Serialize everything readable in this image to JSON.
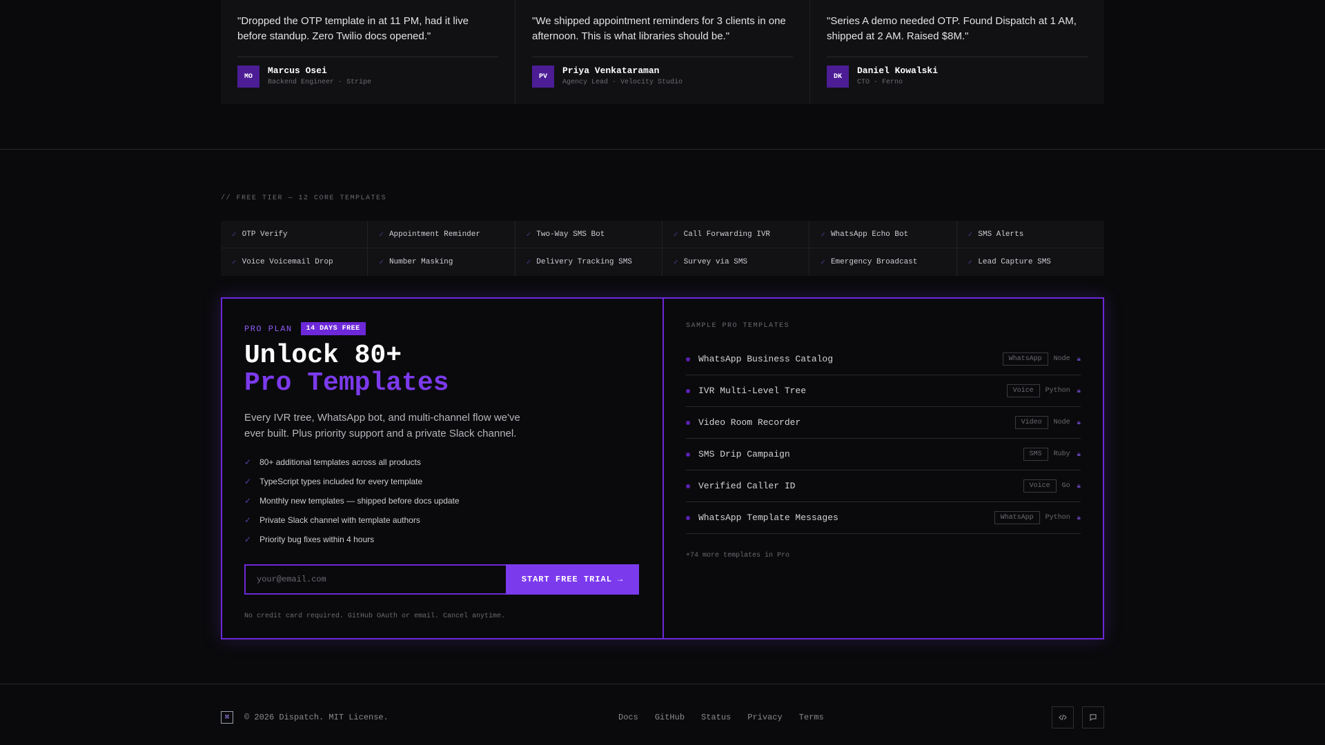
{
  "testimonials": [
    {
      "quote": "\"Dropped the OTP template in at 11 PM, had it live before standup. Zero Twilio docs opened.\"",
      "initials": "MO",
      "name": "Marcus Osei",
      "role": "Backend Engineer · Stripe"
    },
    {
      "quote": "\"We shipped appointment reminders for 3 clients in one afternoon. This is what libraries should be.\"",
      "initials": "PV",
      "name": "Priya Venkataraman",
      "role": "Agency Lead · Velocity Studio"
    },
    {
      "quote": "\"Series A demo needed OTP. Found Dispatch at 1 AM, shipped at 2 AM. Raised $8M.\"",
      "initials": "DK",
      "name": "Daniel Kowalski",
      "role": "CTO · Ferno"
    }
  ],
  "free_tier": {
    "label": "// FREE TIER — 12 CORE TEMPLATES",
    "items": [
      "OTP Verify",
      "Appointment Reminder",
      "Two-Way SMS Bot",
      "Call Forwarding IVR",
      "WhatsApp Echo Bot",
      "SMS Alerts",
      "Voice Voicemail Drop",
      "Number Masking",
      "Delivery Tracking SMS",
      "Survey via SMS",
      "Emergency Broadcast",
      "Lead Capture SMS"
    ]
  },
  "pro": {
    "plan_label": "PRO PLAN",
    "badge": "14 DAYS FREE",
    "headline_1": "Unlock 80+",
    "headline_2": "Pro Templates",
    "description": "Every IVR tree, WhatsApp bot, and multi-channel flow we've ever built. Plus priority support and a private Slack channel.",
    "features": [
      "80+ additional templates across all products",
      "TypeScript types included for every template",
      "Monthly new templates — shipped before docs update",
      "Private Slack channel with template authors",
      "Priority bug fixes within 4 hours"
    ],
    "email_placeholder": "your@email.com",
    "cta": "START FREE TRIAL →",
    "fine_print": "No credit card required. GitHub OAuth or email. Cancel anytime.",
    "accent_color": "#7c3aed"
  },
  "samples": {
    "label": "SAMPLE PRO TEMPLATES",
    "items": [
      {
        "name": "WhatsApp Business Catalog",
        "tag": "WhatsApp",
        "lang": "Node"
      },
      {
        "name": "IVR Multi-Level Tree",
        "tag": "Voice",
        "lang": "Python"
      },
      {
        "name": "Video Room Recorder",
        "tag": "Video",
        "lang": "Node"
      },
      {
        "name": "SMS Drip Campaign",
        "tag": "SMS",
        "lang": "Ruby"
      },
      {
        "name": "Verified Caller ID",
        "tag": "Voice",
        "lang": "Go"
      },
      {
        "name": "WhatsApp Template Messages",
        "tag": "WhatsApp",
        "lang": "Python"
      }
    ],
    "more": "+74 more templates in Pro"
  },
  "footer": {
    "copyright": "© 2026 Dispatch. MIT License.",
    "links": [
      "Docs",
      "GitHub",
      "Status",
      "Privacy",
      "Terms"
    ],
    "icons": [
      "code-icon",
      "chat-icon"
    ]
  }
}
